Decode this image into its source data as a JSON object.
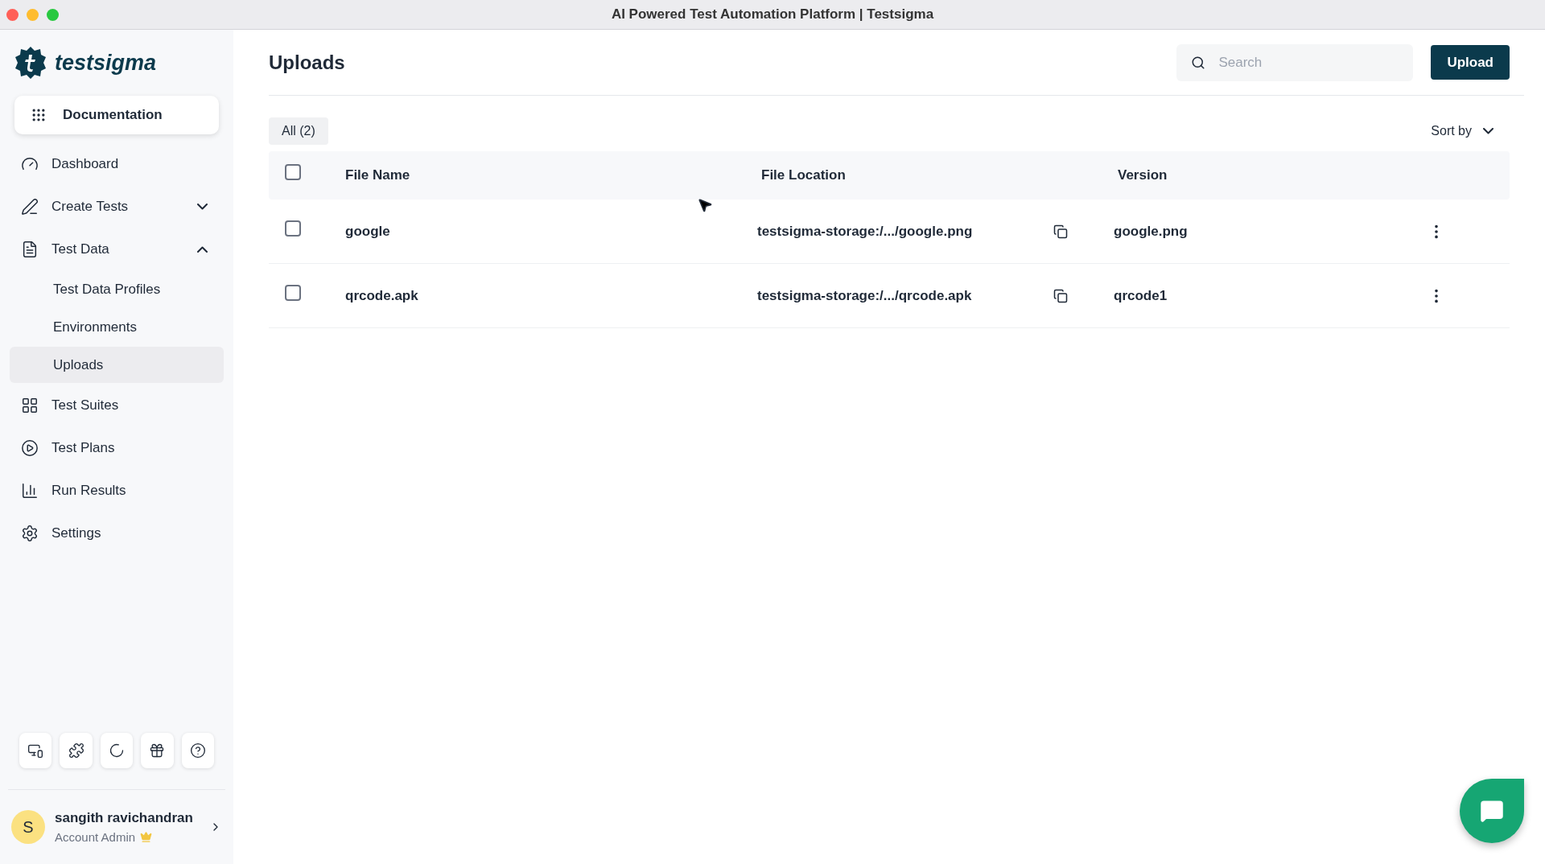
{
  "window": {
    "title": "AI Powered Test Automation Platform | Testsigma"
  },
  "brand": {
    "name": "testsigma"
  },
  "documentation": {
    "label": "Documentation"
  },
  "sidebar": {
    "items": [
      {
        "label": "Dashboard",
        "selected": false
      },
      {
        "label": "Create Tests",
        "selected": false,
        "expanded": false
      },
      {
        "label": "Test Data",
        "selected": false,
        "expanded": true,
        "children": [
          {
            "label": "Test Data Profiles",
            "selected": false
          },
          {
            "label": "Environments",
            "selected": false
          },
          {
            "label": "Uploads",
            "selected": true
          }
        ]
      },
      {
        "label": "Test Suites",
        "selected": false
      },
      {
        "label": "Test Plans",
        "selected": false
      },
      {
        "label": "Run Results",
        "selected": false
      },
      {
        "label": "Settings",
        "selected": false
      }
    ]
  },
  "user": {
    "initial": "S",
    "name": "sangith ravichandran",
    "role": "Account Admin"
  },
  "page": {
    "title": "Uploads",
    "search": {
      "placeholder": "Search"
    },
    "upload_button": "Upload"
  },
  "filter": {
    "label": "All (2)",
    "selected": true
  },
  "sort": {
    "label": "Sort by"
  },
  "table": {
    "header_checked": false,
    "columns": [
      "File Name",
      "File Location",
      "Version"
    ],
    "rows": [
      {
        "checked": false,
        "file_name": "google",
        "file_location": "testsigma-storage:/.../google.png",
        "version": "google.png"
      },
      {
        "checked": false,
        "file_name": "qrcode.apk",
        "file_location": "testsigma-storage:/.../qrcode.apk",
        "version": "qrcode1"
      }
    ]
  }
}
